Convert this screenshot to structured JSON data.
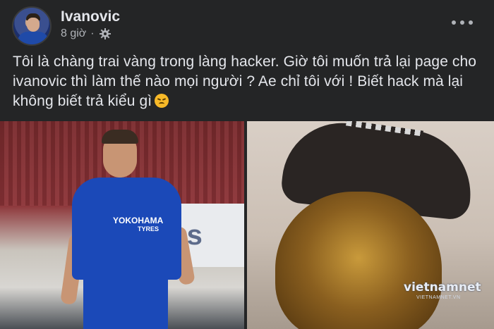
{
  "post": {
    "author": "Ivanovic",
    "time": "8 giờ",
    "separator": "·",
    "privacy_icon": "gear-icon",
    "more_icon": "more-options-icon",
    "text": "Tôi là chàng trai vàng trong làng hacker. Giờ tôi muốn trả lại page cho ivanovic thì làm thế nào mọi người ? Ae chỉ tôi với ! Biết hack mà lại không biết trả kiểu gì",
    "emoji": "disappointed-face-emoji"
  },
  "photos": {
    "left": {
      "banner_text": "fes",
      "sponsor": "YOKOHAMA",
      "sponsor_sub": "TYRES"
    },
    "right": {
      "watermark": "vietnamnet",
      "watermark_sub": "VIETNAMNET.VN"
    }
  },
  "colors": {
    "background": "#242526",
    "text": "#e4e6eb",
    "secondary_text": "#b0b3b8"
  }
}
